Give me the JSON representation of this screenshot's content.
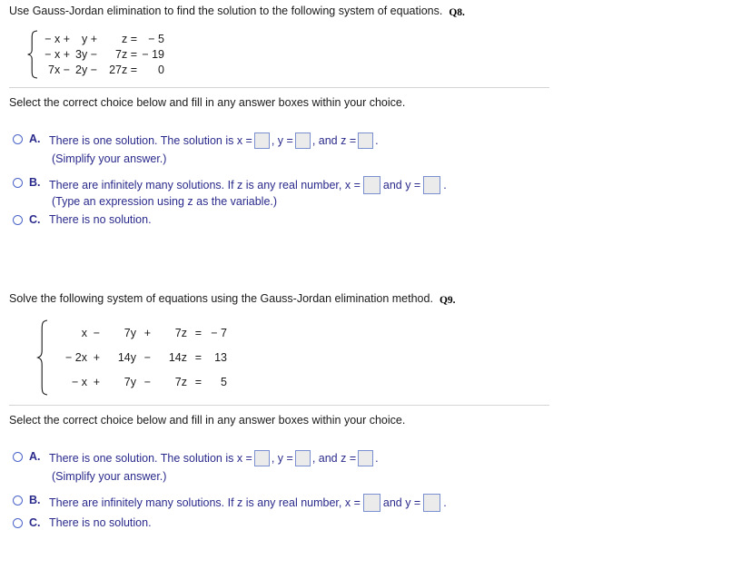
{
  "questions": [
    {
      "tag": "Q8.",
      "prompt": "Use Gauss-Jordan elimination to find the solution to the following system of equations.",
      "system": {
        "rows": [
          {
            "c1": "− x +",
            "c2": "y +",
            "c3": "z =",
            "c4": "",
            "c5": "− 5"
          },
          {
            "c1": "− x +",
            "c2": "3y −",
            "c3": "7z =",
            "c4": "",
            "c5": "− 19"
          },
          {
            "c1": "7x −",
            "c2": "2y −",
            "c3": "27z =",
            "c4": "",
            "c5": "0"
          }
        ]
      },
      "instruction": "Select the correct choice below and fill in any answer boxes within your choice.",
      "choices": [
        {
          "label": "A.",
          "parts": [
            {
              "type": "text",
              "value": "There is one solution. The solution is x ="
            },
            {
              "type": "box",
              "size": "sm"
            },
            {
              "type": "text",
              "value": ", y ="
            },
            {
              "type": "box",
              "size": "sm"
            },
            {
              "type": "text",
              "value": ", and z ="
            },
            {
              "type": "box",
              "size": "sm"
            },
            {
              "type": "text",
              "value": "."
            }
          ],
          "hint": "(Simplify your answer.)"
        },
        {
          "label": "B.",
          "parts": [
            {
              "type": "text",
              "value": "There are infinitely many solutions. If z is any real number, x ="
            },
            {
              "type": "box",
              "size": "md"
            },
            {
              "type": "text",
              "value": "and y ="
            },
            {
              "type": "box",
              "size": "md"
            },
            {
              "type": "text",
              "value": "."
            }
          ],
          "hint": "(Type an expression using z as the variable.)"
        },
        {
          "label": "C.",
          "parts": [
            {
              "type": "text",
              "value": "There is no solution."
            }
          ],
          "hint": null
        }
      ]
    },
    {
      "tag": "Q9.",
      "prompt": "Solve the following system of equations using the Gauss-Jordan elimination method.",
      "system": {
        "rows": [
          {
            "c1": "x",
            "c2": "−",
            "c3": "7y",
            "c4": "+",
            "c5": "7z",
            "c6": "=",
            "c7": "− 7"
          },
          {
            "c1": "− 2x",
            "c2": "+",
            "c3": "14y",
            "c4": "−",
            "c5": "14z",
            "c6": "=",
            "c7": "13"
          },
          {
            "c1": "− x",
            "c2": "+",
            "c3": "7y",
            "c4": "−",
            "c5": "7z",
            "c6": "=",
            "c7": "5"
          }
        ]
      },
      "instruction": "Select the correct choice below and fill in any answer boxes within your choice.",
      "choices": [
        {
          "label": "A.",
          "parts": [
            {
              "type": "text",
              "value": "There is one solution. The solution is x ="
            },
            {
              "type": "box",
              "size": "sm"
            },
            {
              "type": "text",
              "value": ", y ="
            },
            {
              "type": "box",
              "size": "sm"
            },
            {
              "type": "text",
              "value": ", and z ="
            },
            {
              "type": "box",
              "size": "sm"
            },
            {
              "type": "text",
              "value": "."
            }
          ],
          "hint": "(Simplify your answer.)"
        },
        {
          "label": "B.",
          "parts": [
            {
              "type": "text",
              "value": "There are infinitely many solutions. If z is any real number, x ="
            },
            {
              "type": "box",
              "size": "md"
            },
            {
              "type": "text",
              "value": "and y ="
            },
            {
              "type": "box",
              "size": "md"
            },
            {
              "type": "text",
              "value": "."
            }
          ],
          "hint": null
        },
        {
          "label": "C.",
          "parts": [
            {
              "type": "text",
              "value": "There is no solution."
            }
          ],
          "hint": null
        }
      ]
    }
  ],
  "colors": {
    "body_text": "#1a1a1a",
    "choice_text": "#2a2a8c",
    "radio_border": "#4a63c8",
    "box_fill": "#ebebeb",
    "box_border": "#7a8fd0",
    "divider": "#d4d4d4"
  }
}
